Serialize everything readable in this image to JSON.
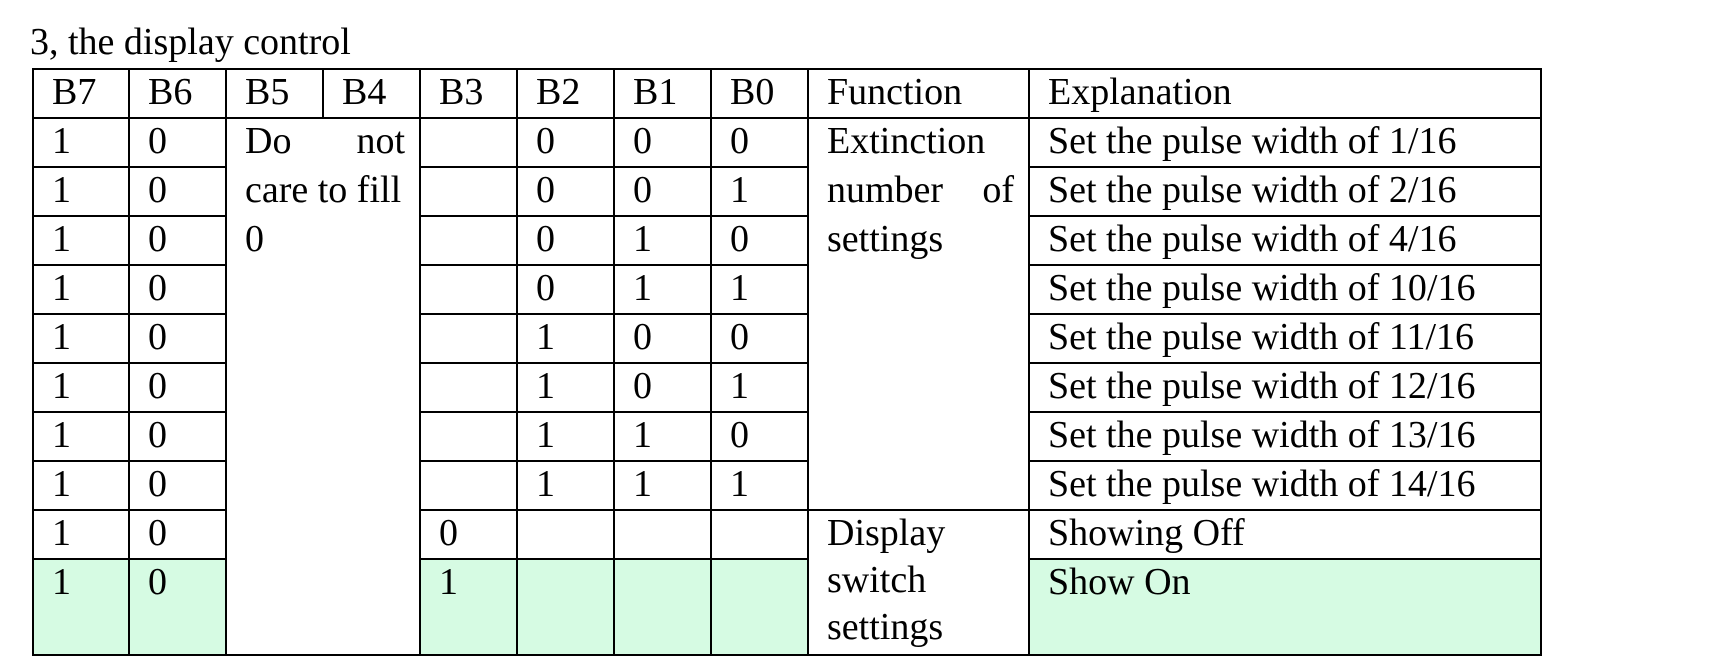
{
  "heading": "3, the display control",
  "table": {
    "headers": [
      "B7",
      "B6",
      "B5",
      "B4",
      "B3",
      "B2",
      "B1",
      "B0",
      "Function",
      "Explanation"
    ],
    "dont_care": {
      "line1_a": "Do",
      "line1_b": "not",
      "line2": "care to fill",
      "line3": "0"
    },
    "function_extinction": {
      "line1": "Extinction",
      "line2_a": "number",
      "line2_b": "of",
      "line3": "settings"
    },
    "function_display": {
      "line1": "Display",
      "line2": "switch",
      "line3": "settings"
    },
    "rows": [
      {
        "b7": "1",
        "b6": "0",
        "b3": "",
        "b2": "0",
        "b1": "0",
        "b0": "0",
        "explanation": "Set the pulse width of 1/16"
      },
      {
        "b7": "1",
        "b6": "0",
        "b3": "",
        "b2": "0",
        "b1": "0",
        "b0": "1",
        "explanation": "Set the pulse width of 2/16"
      },
      {
        "b7": "1",
        "b6": "0",
        "b3": "",
        "b2": "0",
        "b1": "1",
        "b0": "0",
        "explanation": "Set the pulse width of 4/16"
      },
      {
        "b7": "1",
        "b6": "0",
        "b3": "",
        "b2": "0",
        "b1": "1",
        "b0": "1",
        "explanation": "Set the pulse width of 10/16"
      },
      {
        "b7": "1",
        "b6": "0",
        "b3": "",
        "b2": "1",
        "b1": "0",
        "b0": "0",
        "explanation": "Set the pulse width of 11/16"
      },
      {
        "b7": "1",
        "b6": "0",
        "b3": "",
        "b2": "1",
        "b1": "0",
        "b0": "1",
        "explanation": "Set the pulse width of 12/16"
      },
      {
        "b7": "1",
        "b6": "0",
        "b3": "",
        "b2": "1",
        "b1": "1",
        "b0": "0",
        "explanation": "Set the pulse width of 13/16"
      },
      {
        "b7": "1",
        "b6": "0",
        "b3": "",
        "b2": "1",
        "b1": "1",
        "b0": "1",
        "explanation": "Set the pulse width of 14/16"
      },
      {
        "b7": "1",
        "b6": "0",
        "b3": "0",
        "b2": "",
        "b1": "",
        "b0": "",
        "explanation": "Showing Off"
      },
      {
        "b7": "1",
        "b6": "0",
        "b3": "1",
        "b2": "",
        "b1": "",
        "b0": "",
        "explanation": "Show On"
      }
    ],
    "highlight_color": "#d6fbe3"
  }
}
